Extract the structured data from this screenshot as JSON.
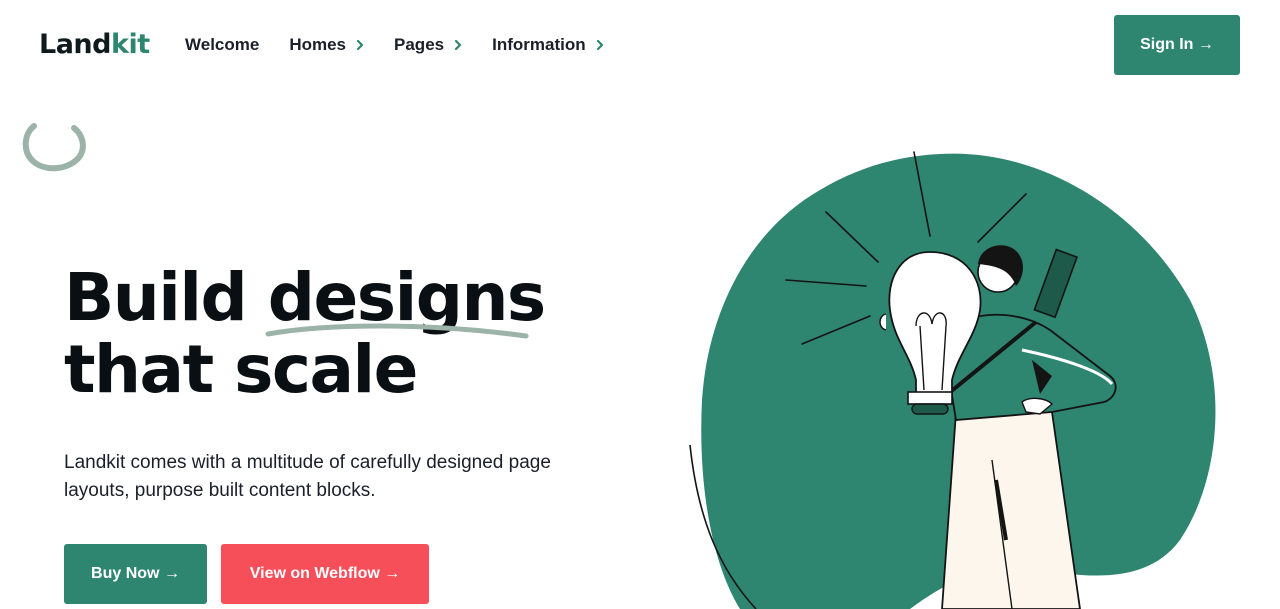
{
  "brand": {
    "name_dark": "Land",
    "name_accent": "kit"
  },
  "nav": {
    "items": [
      {
        "label": "Welcome",
        "has_chevron": false
      },
      {
        "label": "Homes",
        "has_chevron": true
      },
      {
        "label": "Pages",
        "has_chevron": true
      },
      {
        "label": "Information",
        "has_chevron": true
      }
    ],
    "signin_label": "Sign In →"
  },
  "hero": {
    "title_line1_a": "Build",
    "title_line1_b": "designs",
    "title_line2": "that scale",
    "description": "Landkit comes with a multitude of carefully designed page layouts, purpose built content blocks.",
    "buy_label": "Buy Now →",
    "webflow_label": "View on Webflow →"
  },
  "colors": {
    "primary": "#2e8570",
    "danger": "#f74f59",
    "text": "#161c2d",
    "muted_stroke": "#9bb3a8"
  },
  "icons": {
    "chevron": "chevron-right-icon",
    "loader": "spinner-icon",
    "illustration": "lightbulb-person-illustration"
  }
}
